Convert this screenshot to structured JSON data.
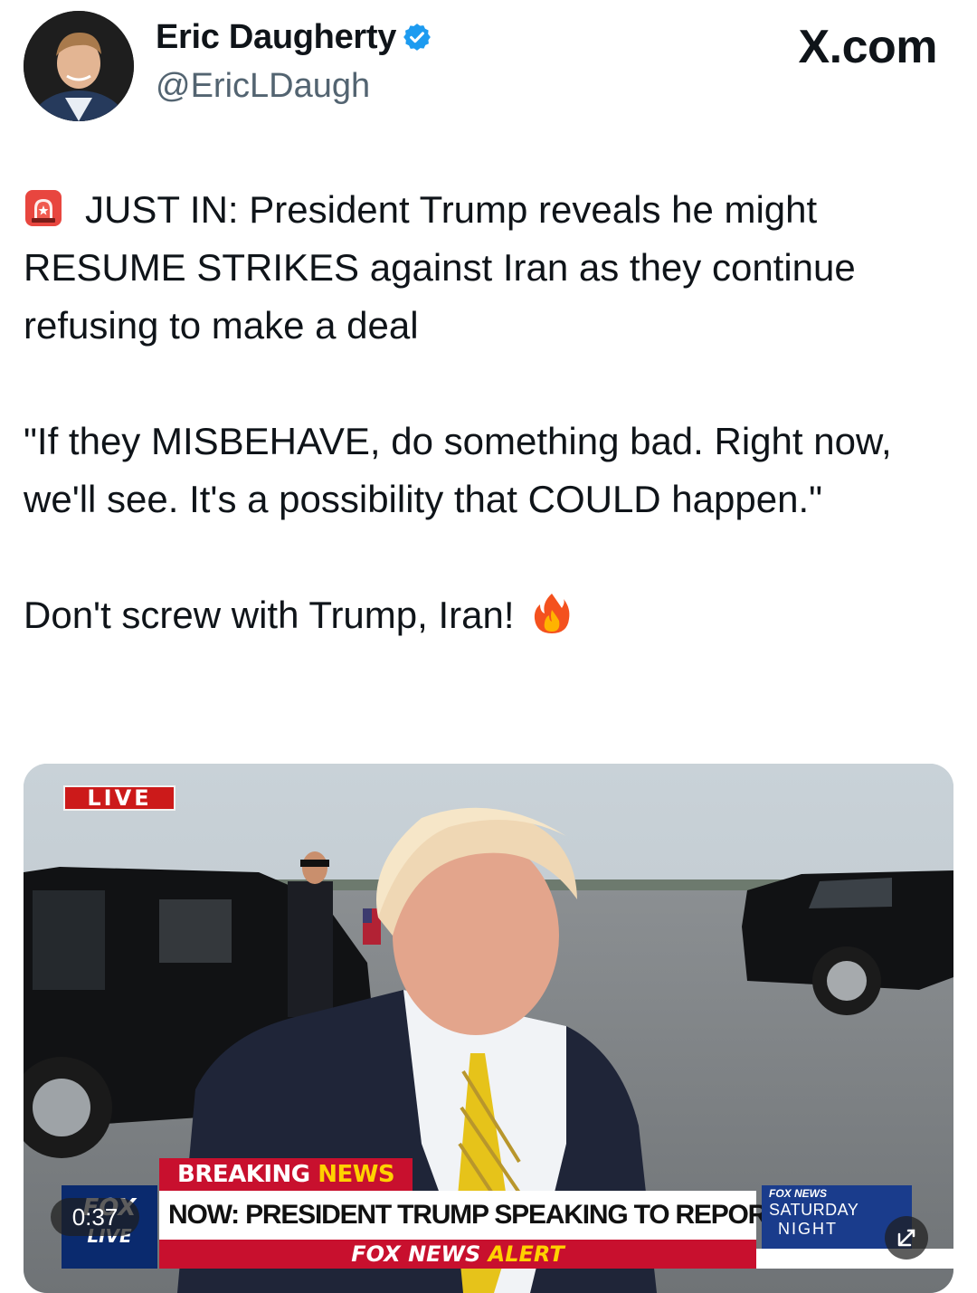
{
  "author": {
    "name": "Eric Daugherty",
    "handle": "@EricLDaugh",
    "verified": true,
    "verified_color": "#1d9bf0",
    "avatar_icon": "profile-photo"
  },
  "site_mark": "X.com",
  "post": {
    "paragraphs": [
      "JUST IN: President Trump reveals he might RESUME STRIKES against Iran as they continue refusing to make a deal",
      "\"If they MISBEHAVE, do something bad. Right now, we'll see. It's a possibility that COULD happen.\"",
      "Don't screw with Trump, Iran!"
    ],
    "leading_emoji": "police-siren-icon",
    "trailing_emoji": "fire-icon"
  },
  "video": {
    "live_badge": "LIVE",
    "breaking_label": "BREAKING",
    "breaking_label_accent": " NEWS",
    "chyron": "NOW: PRESIDENT TRUMP SPEAKING TO REPORTERS",
    "alert_prefix": "FOX NEWS ",
    "alert_accent": "ALERT",
    "network_logo_text": "FOX",
    "network_logo_sub": "LIVE",
    "show_network": "FOX NEWS",
    "show_line1": "SATURDAY",
    "show_line2": "NIGHT",
    "timestamp": "0:37",
    "accent_red": "#c8102e",
    "accent_yellow": "#ffd200",
    "fox_blue": "#0a2a6e"
  }
}
